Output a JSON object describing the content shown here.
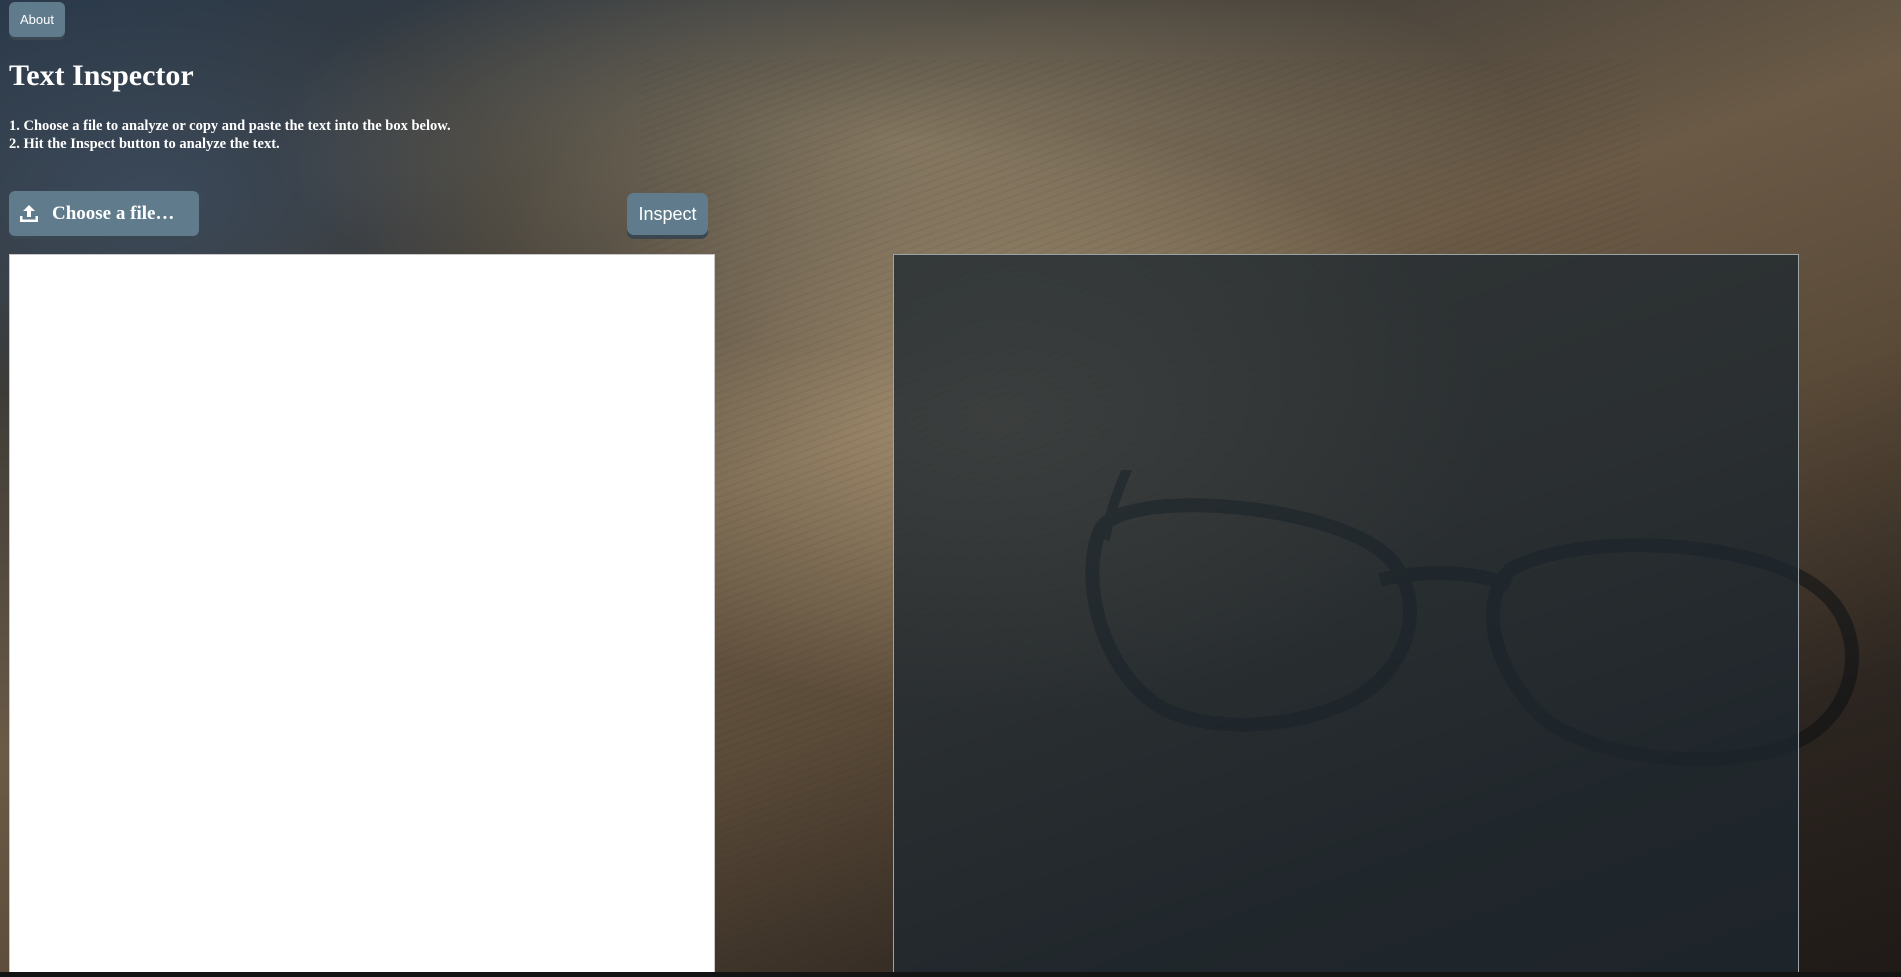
{
  "header": {
    "about_label": "About",
    "title": "Text Inspector"
  },
  "instructions": [
    "1. Choose a file to analyze or copy and paste the text into the box below.",
    "2. Hit the Inspect button to analyze the text."
  ],
  "controls": {
    "choose_file_label": "Choose a file…",
    "choose_file_icon": "upload-icon",
    "inspect_label": "Inspect"
  },
  "editor": {
    "value": "",
    "placeholder": ""
  },
  "colors": {
    "button": "#5f7b8c",
    "button_shadow": "#3a4750",
    "results_panel": "#1e2830"
  }
}
